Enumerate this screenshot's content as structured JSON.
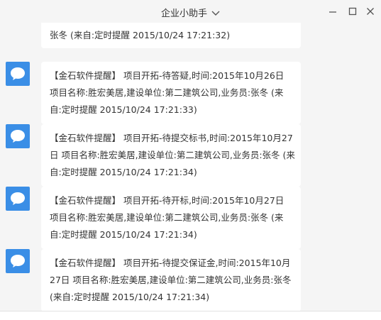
{
  "window": {
    "title": "企业小助手"
  },
  "messages": [
    {
      "text": "张冬 (来自:定时提醒 2015/10/24 17:21:32)"
    },
    {
      "text": "【金石软件提醒】 项目开拓-待答疑,时间:2015年10月26日 项目名称:胜宏美居,建设单位:第二建筑公司,业务员:张冬 (来自:定时提醒 2015/10/24 17:21:33)"
    },
    {
      "text": "【金石软件提醒】 项目开拓-待提交标书,时间:2015年10月27日 项目名称:胜宏美居,建设单位:第二建筑公司,业务员:张冬 (来自:定时提醒 2015/10/24 17:21:34)"
    },
    {
      "text": "【金石软件提醒】 项目开拓-待开标,时间:2015年10月27日 项目名称:胜宏美居,建设单位:第二建筑公司,业务员:张冬 (来自:定时提醒 2015/10/24 17:21:34)"
    },
    {
      "text": "【金石软件提醒】 项目开拓-待提交保证金,时间:2015年10月27日 项目名称:胜宏美居,建设单位:第二建筑公司,业务员:张冬 (来自:定时提醒 2015/10/24 17:21:34)"
    }
  ],
  "icons": {
    "avatar": "chat-bubble-icon",
    "dropdown": "chevron-down-icon",
    "minimize": "minimize-icon",
    "maximize": "maximize-icon",
    "close": "close-icon"
  },
  "colors": {
    "avatar_bg": "#3a8ee6",
    "bubble_bg": "#ffffff",
    "window_bg": "#f5f5f5"
  }
}
